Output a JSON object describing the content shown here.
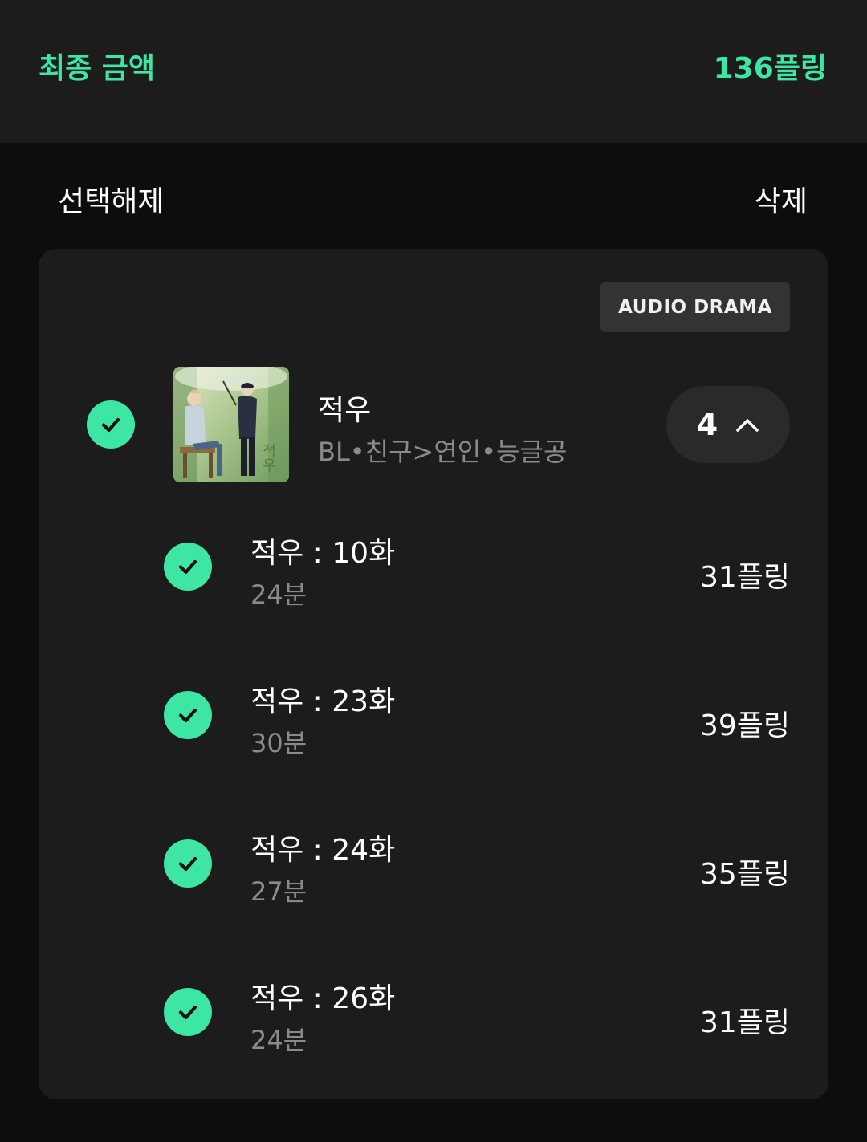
{
  "summary": {
    "total_label": "최종 금액",
    "total_value": "136플링",
    "accent_color": "#3ee6a3"
  },
  "actions": {
    "deselect_label": "선택해제",
    "delete_label": "삭제"
  },
  "album": {
    "badge": "AUDIO DRAMA",
    "title": "적우",
    "tags": "BL•친구>연인•능글공",
    "selected_count": "4",
    "cover_text": "적우"
  },
  "episodes": [
    {
      "title": "적우 : 10화",
      "duration": "24분",
      "price": "31플링"
    },
    {
      "title": "적우 : 23화",
      "duration": "30분",
      "price": "39플링"
    },
    {
      "title": "적우 : 24화",
      "duration": "27분",
      "price": "35플링"
    },
    {
      "title": "적우 : 26화",
      "duration": "24분",
      "price": "31플링"
    }
  ]
}
